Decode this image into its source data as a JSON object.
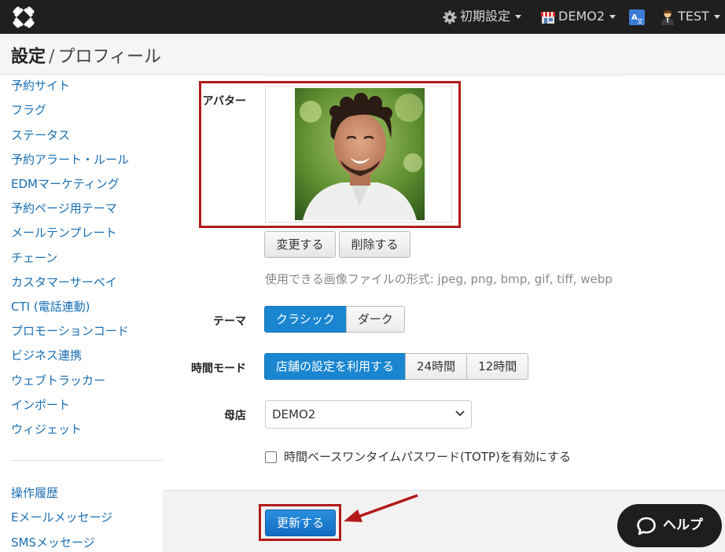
{
  "navbar": {
    "settings_label": "初期設定",
    "store_label": "DEMO2",
    "user_label": "TEST",
    "icons": [
      "app-logo-icon",
      "gear-icon",
      "store-icon",
      "translate-icon",
      "user-icon"
    ]
  },
  "header": {
    "title": "設定",
    "separator": "/",
    "subtitle": "プロフィール"
  },
  "sidebar": {
    "items": [
      "予約サイト",
      "フラグ",
      "ステータス",
      "予約アラート・ルール",
      "EDMマーケティング",
      "予約ページ用テーマ",
      "メールテンプレート",
      "チェーン",
      "カスタマーサーベイ",
      "CTI (電話連動)",
      "プロモーションコード",
      "ビジネス連携",
      "ウェブトラッカー",
      "インポート",
      "ウィジェット"
    ],
    "items2": [
      "操作履歴",
      "Eメールメッセージ",
      "SMSメッセージ"
    ]
  },
  "form": {
    "avatar_label": "アバター",
    "change_button": "変更する",
    "delete_button": "削除する",
    "file_hint": "使用できる画像ファイルの形式: jpeg, png, bmp, gif, tiff, webp",
    "theme_label": "テーマ",
    "theme_options": [
      "クラシック",
      "ダーク"
    ],
    "theme_selected": "クラシック",
    "time_mode_label": "時間モード",
    "time_mode_options": [
      "店舗の設定を利用する",
      "24時間",
      "12時間"
    ],
    "time_mode_selected": "店舗の設定を利用する",
    "parent_store_label": "母店",
    "parent_store_value": "DEMO2",
    "totp_label": "時間ベースワンタイムパスワード(TOTP)を有効にする",
    "totp_checked": false,
    "submit_button": "更新する"
  },
  "help": {
    "label": "ヘルプ"
  },
  "colors": {
    "accent": "#1a86d0",
    "highlight_frame": "#b31b1b",
    "navbar": "#1f1f1f",
    "link": "#1a6fb3"
  }
}
